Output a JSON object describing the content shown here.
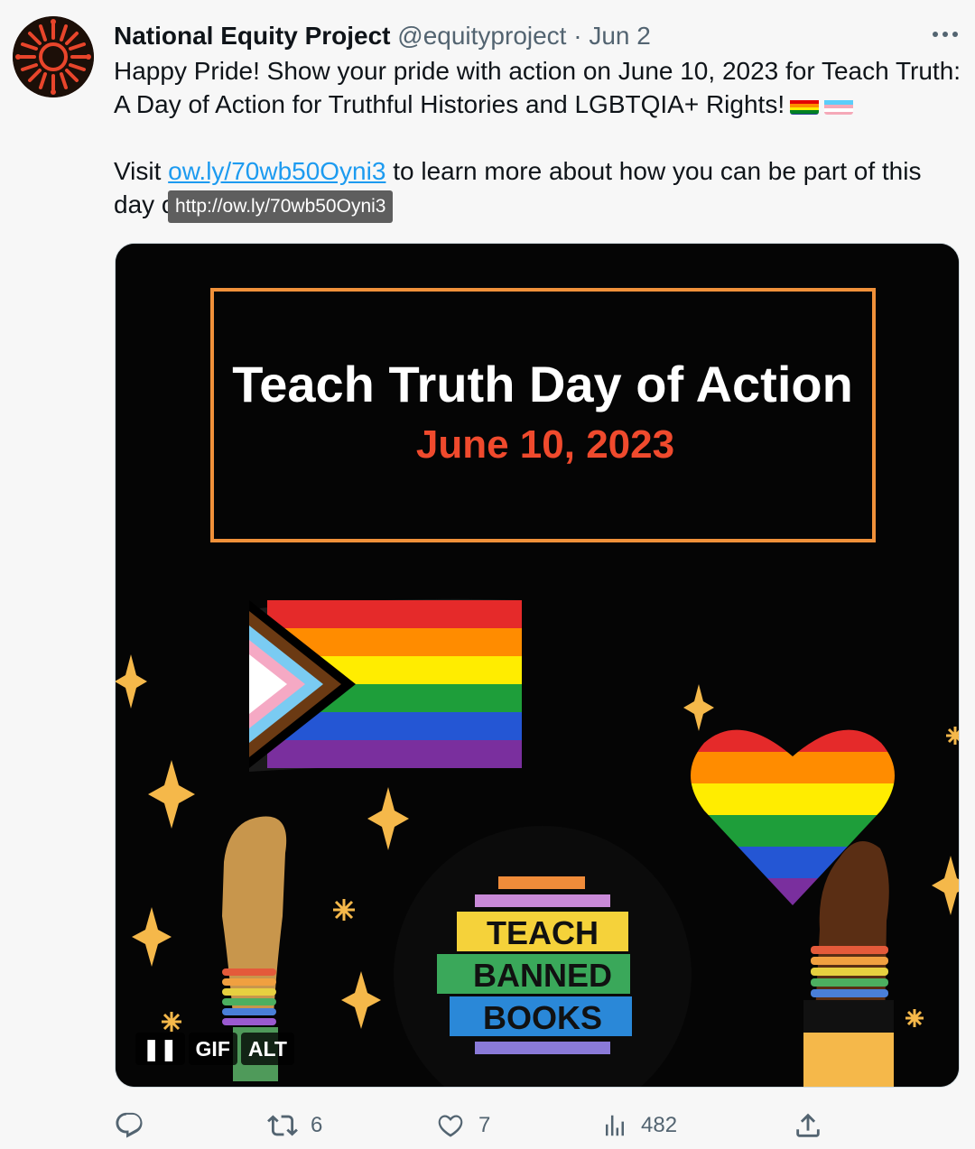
{
  "tweet": {
    "author_name": "National Equity Project",
    "handle": "@equityproject",
    "separator": " · ",
    "date": "Jun 2",
    "text_line1": "Happy Pride! Show your pride with action on June 10, 2023 for Teach Truth: A Day of Action for Truthful Histories and LGBTQIA+ Rights!",
    "text2_prefix": "Visit ",
    "link_text": "ow.ly/70wb50Oyni3",
    "text2_suffix": " to learn more about how you can be part of this day of action",
    "tooltip": "http://ow.ly/70wb50Oyni3"
  },
  "media": {
    "poster_title": "Teach Truth Day of Action",
    "poster_date": "June 10, 2023",
    "book_1": "TEACH",
    "book_2": "BANNED",
    "book_3": "BOOKS",
    "controls": {
      "pause": "❚❚",
      "gif": "GIF",
      "alt": "ALT"
    }
  },
  "actions": {
    "reply_count": "",
    "retweet_count": "6",
    "like_count": "7",
    "views_count": "482"
  },
  "colors": {
    "link": "#1d9bf0",
    "frame_orange": "#f0913a",
    "date_red": "#f04a2d",
    "muted": "#536471"
  },
  "icons": [
    "more-icon",
    "reply-icon",
    "retweet-icon",
    "like-icon",
    "views-icon",
    "share-icon",
    "pride-flag-emoji",
    "trans-flag-emoji"
  ]
}
